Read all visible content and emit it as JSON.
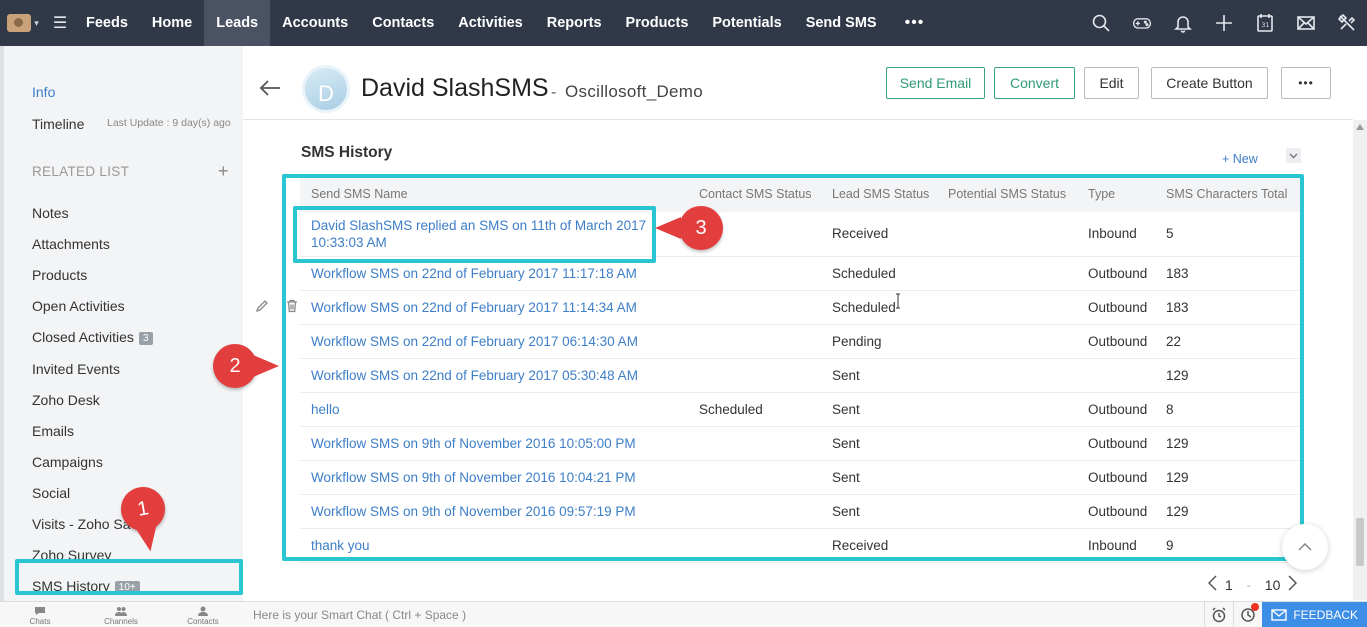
{
  "nav": {
    "items": [
      {
        "label": "Feeds",
        "active": false
      },
      {
        "label": "Home",
        "active": false
      },
      {
        "label": "Leads",
        "active": true
      },
      {
        "label": "Accounts",
        "active": false
      },
      {
        "label": "Contacts",
        "active": false
      },
      {
        "label": "Activities",
        "active": false
      },
      {
        "label": "Reports",
        "active": false
      },
      {
        "label": "Products",
        "active": false
      },
      {
        "label": "Potentials",
        "active": false
      },
      {
        "label": "Send SMS",
        "active": false
      }
    ],
    "more": "•••",
    "right_icons": [
      "search-icon",
      "gamepad-icon",
      "bell-icon",
      "plus-icon",
      "calendar-icon",
      "mail-icon",
      "tools-icon"
    ],
    "calendar_day": "31"
  },
  "sidebar": {
    "info": "Info",
    "timeline": "Timeline",
    "last_update": "Last Update : 9 day(s) ago",
    "related_heading": "RELATED LIST",
    "add": "+",
    "items": [
      {
        "label": "Notes",
        "badge": ""
      },
      {
        "label": "Attachments",
        "badge": ""
      },
      {
        "label": "Products",
        "badge": ""
      },
      {
        "label": "Open Activities",
        "badge": ""
      },
      {
        "label": "Closed Activities",
        "badge": "3"
      },
      {
        "label": "Invited Events",
        "badge": ""
      },
      {
        "label": "Zoho Desk",
        "badge": ""
      },
      {
        "label": "Emails",
        "badge": ""
      },
      {
        "label": "Campaigns",
        "badge": ""
      },
      {
        "label": "Social",
        "badge": ""
      },
      {
        "label": "Visits - Zoho Sa",
        "badge": ""
      },
      {
        "label": "Zoho Survey",
        "badge": ""
      },
      {
        "label": "SMS History",
        "badge": "10+"
      }
    ]
  },
  "record": {
    "avatar_letter": "D",
    "name": "David SlashSMS",
    "separator": "-",
    "account": "Oscillosoft_Demo",
    "buttons": {
      "send_email": "Send Email",
      "convert": "Convert",
      "edit": "Edit",
      "create_button": "Create Button",
      "more": "•••"
    }
  },
  "section": {
    "title": "SMS History",
    "new_label": "+ New"
  },
  "table": {
    "columns": [
      "Send SMS Name",
      "Contact SMS Status",
      "Lead SMS Status",
      "Potential SMS Status",
      "Type",
      "SMS Characters Total"
    ],
    "rows": [
      {
        "name": "David SlashSMS replied an SMS on 11th of March 2017 10:33:03 AM",
        "contact_status": "",
        "lead_status": "Received",
        "potential_status": "",
        "type": "Inbound",
        "chars": "5"
      },
      {
        "name": "Workflow SMS on 22nd of February 2017 11:17:18 AM",
        "contact_status": "",
        "lead_status": "Scheduled",
        "potential_status": "",
        "type": "Outbound",
        "chars": "183"
      },
      {
        "name": "Workflow SMS on 22nd of February 2017 11:14:34 AM",
        "contact_status": "",
        "lead_status": "Scheduled",
        "potential_status": "",
        "type": "Outbound",
        "chars": "183"
      },
      {
        "name": "Workflow SMS on 22nd of February 2017 06:14:30 AM",
        "contact_status": "",
        "lead_status": "Pending",
        "potential_status": "",
        "type": "Outbound",
        "chars": "22"
      },
      {
        "name": "Workflow SMS on 22nd of February 2017 05:30:48 AM",
        "contact_status": "",
        "lead_status": "Sent",
        "potential_status": "",
        "type": "",
        "chars": "129"
      },
      {
        "name": "hello",
        "contact_status": "Scheduled",
        "lead_status": "Sent",
        "potential_status": "",
        "type": "Outbound",
        "chars": "8"
      },
      {
        "name": "Workflow SMS on 9th of November 2016 10:05:00 PM",
        "contact_status": "",
        "lead_status": "Sent",
        "potential_status": "",
        "type": "Outbound",
        "chars": "129"
      },
      {
        "name": "Workflow SMS on 9th of November 2016 10:04:21 PM",
        "contact_status": "",
        "lead_status": "Sent",
        "potential_status": "",
        "type": "Outbound",
        "chars": "129"
      },
      {
        "name": "Workflow SMS on 9th of November 2016 09:57:19 PM",
        "contact_status": "",
        "lead_status": "Sent",
        "potential_status": "",
        "type": "Outbound",
        "chars": "129"
      },
      {
        "name": "thank you",
        "contact_status": "",
        "lead_status": "Received",
        "potential_status": "",
        "type": "Inbound",
        "chars": "9"
      }
    ]
  },
  "pagination": {
    "from": "1",
    "sep": "-",
    "to": "10"
  },
  "callouts": {
    "one": "1",
    "two": "2",
    "three": "3"
  },
  "bottombar": {
    "tabs": [
      "Chats",
      "Channels",
      "Contacts"
    ],
    "chat_placeholder": "Here is your Smart Chat ( Ctrl + Space )",
    "feedback": "FEEDBACK"
  },
  "colors": {
    "highlight": "#29c6d1",
    "callout": "#e33e3e",
    "nav_bg": "#313949",
    "link": "#3d7ec8",
    "green": "#2f9b74"
  }
}
